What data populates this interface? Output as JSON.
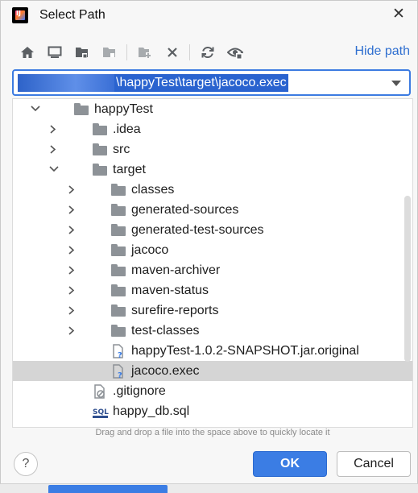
{
  "window": {
    "title": "Select Path"
  },
  "toolbar": {
    "buttons": [
      {
        "icon": "home-icon"
      },
      {
        "icon": "desktop-icon"
      },
      {
        "icon": "project-icon"
      },
      {
        "icon": "module-icon"
      },
      {
        "icon": "new-folder-icon"
      },
      {
        "icon": "delete-icon"
      },
      {
        "icon": "refresh-icon"
      },
      {
        "icon": "show-hidden-icon"
      }
    ],
    "hide_path_label": "Hide path"
  },
  "path": {
    "value_visible": "\\happyTest\\target\\jacoco.exec"
  },
  "tree": {
    "rows": [
      {
        "label": "happyTest",
        "type": "folder",
        "level": 0,
        "expanded": true
      },
      {
        "label": ".idea",
        "type": "folder",
        "level": 1,
        "expanded": false
      },
      {
        "label": "src",
        "type": "folder",
        "level": 1,
        "expanded": false
      },
      {
        "label": "target",
        "type": "folder",
        "level": 1,
        "expanded": true
      },
      {
        "label": "classes",
        "type": "folder",
        "level": 2,
        "expanded": false
      },
      {
        "label": "generated-sources",
        "type": "folder",
        "level": 2,
        "expanded": false
      },
      {
        "label": "generated-test-sources",
        "type": "folder",
        "level": 2,
        "expanded": false
      },
      {
        "label": "jacoco",
        "type": "folder",
        "level": 2,
        "expanded": false
      },
      {
        "label": "maven-archiver",
        "type": "folder",
        "level": 2,
        "expanded": false
      },
      {
        "label": "maven-status",
        "type": "folder",
        "level": 2,
        "expanded": false
      },
      {
        "label": "surefire-reports",
        "type": "folder",
        "level": 2,
        "expanded": false
      },
      {
        "label": "test-classes",
        "type": "folder",
        "level": 2,
        "expanded": false
      },
      {
        "label": "happyTest-1.0.2-SNAPSHOT.jar.original",
        "type": "unknown-file",
        "level": 2
      },
      {
        "label": "jacoco.exec",
        "type": "unknown-file",
        "level": 2,
        "selected": true
      },
      {
        "label": ".gitignore",
        "type": "ignore-file",
        "level": 1
      },
      {
        "label": "happy_db.sql",
        "type": "sql-file",
        "level": 1
      }
    ]
  },
  "hint": "Drag and drop a file into the space above to quickly locate it",
  "buttons": {
    "help": "?",
    "ok": "OK",
    "cancel": "Cancel"
  },
  "colors": {
    "accent": "#3b7de4",
    "selection": "#d5d5d5",
    "link": "#2f6fd0"
  }
}
